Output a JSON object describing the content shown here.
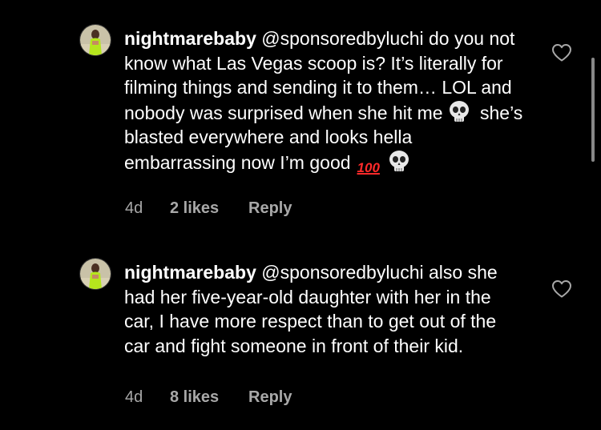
{
  "comments": [
    {
      "username": "nightmarebaby",
      "mention": "@sponsoredbyluchi",
      "text_part1": " do you not know what Las Vegas scoop is? It’s literally for filming things and sending it to them… LOL and nobody was surprised when she hit me",
      "text_part2": " she’s blasted everywhere and looks hella embarrassing now I’m good",
      "emoji_100": "100",
      "age": "4d",
      "likes": "2 likes",
      "reply_label": "Reply"
    },
    {
      "username": "nightmarebaby",
      "mention": "@sponsoredbyluchi",
      "text_part1": " also she had her five-year-old daughter with her in the car, I have more respect than to get out of the car and fight someone in front of their kid.",
      "age": "4d",
      "likes": "8 likes",
      "reply_label": "Reply"
    }
  ],
  "colors": {
    "background": "#000000",
    "text": "#ffffff",
    "meta": "#a8a8a8",
    "emoji_100": "#ff2a2a"
  },
  "icons": [
    "avatar",
    "skull-emoji",
    "hundred-points-emoji",
    "heart-icon"
  ]
}
